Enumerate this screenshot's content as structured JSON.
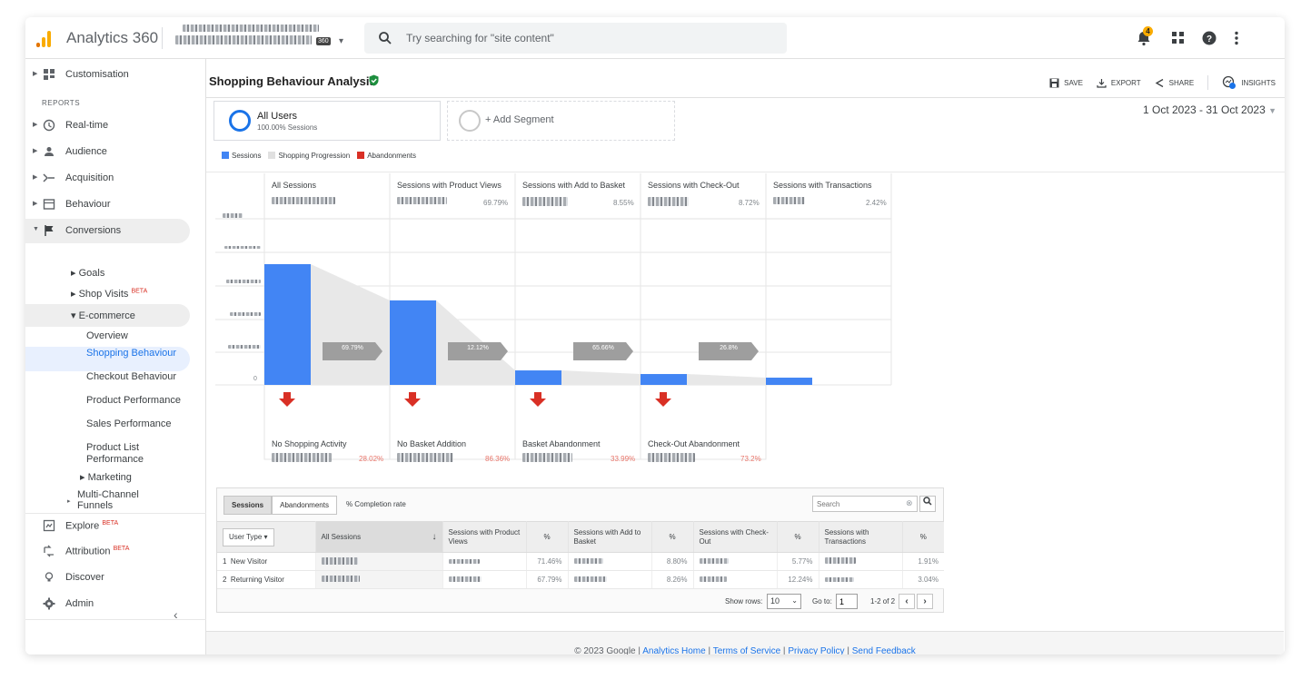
{
  "app": {
    "title": "Analytics 360",
    "search_placeholder": "Try searching for \"site content\"",
    "notification_count": "4",
    "account_badge": "360"
  },
  "sidebar": {
    "customisation": "Customisation",
    "reports_heading": "REPORTS",
    "items": [
      {
        "label": "Real-time"
      },
      {
        "label": "Audience"
      },
      {
        "label": "Acquisition"
      },
      {
        "label": "Behaviour"
      },
      {
        "label": "Conversions"
      }
    ],
    "conversions": {
      "goals": "Goals",
      "shop_visits": "Shop Visits",
      "beta": "BETA",
      "ecommerce": "E-commerce",
      "sub": [
        "Overview",
        "Shopping Behaviour",
        "Checkout Behaviour",
        "Product Performance",
        "Sales Performance",
        "Product List Performance"
      ],
      "marketing": "Marketing",
      "multichannel": "Multi-Channel Funnels"
    },
    "explore": "Explore",
    "attribution": "Attribution",
    "discover": "Discover",
    "admin": "Admin"
  },
  "page": {
    "title": "Shopping Behaviour Analysis",
    "toolbar": {
      "save": "SAVE",
      "export": "EXPORT",
      "share": "SHARE",
      "insights": "INSIGHTS"
    },
    "date_range": "1 Oct 2023 - 31 Oct 2023",
    "segments": [
      {
        "name": "All Users",
        "sub": "100.00% Sessions"
      },
      {
        "name": "+ Add Segment"
      }
    ],
    "legend": [
      "Sessions",
      "Shopping Progression",
      "Abandonments"
    ],
    "colors": {
      "sessions": "#4285f4",
      "progression": "#e8e8e8",
      "abandonment": "#d93025",
      "arrow": "#9e9e9e"
    }
  },
  "funnel": {
    "stages": [
      {
        "label": "All Sessions",
        "pct": ""
      },
      {
        "label": "Sessions with Product Views",
        "pct": "69.79%"
      },
      {
        "label": "Sessions with Add to Basket",
        "pct": "8.55%"
      },
      {
        "label": "Sessions with Check-Out",
        "pct": "8.72%"
      },
      {
        "label": "Sessions with Transactions",
        "pct": "2.42%"
      }
    ],
    "bar_levels": [
      1.0,
      0.7,
      0.12,
      0.09,
      0.06
    ],
    "progression": [
      "69.79%",
      "12.12%",
      "65.66%",
      "26.8%"
    ],
    "abandonments": [
      {
        "label": "No Shopping Activity",
        "pct": "28.02%"
      },
      {
        "label": "No Basket Addition",
        "pct": "86.36%"
      },
      {
        "label": "Basket Abandonment",
        "pct": "33.99%"
      },
      {
        "label": "Check-Out Abandonment",
        "pct": "73.2%"
      }
    ],
    "y_zero": "0"
  },
  "table": {
    "tabs": [
      "Sessions",
      "Abandonments"
    ],
    "completion_tab": "% Completion rate",
    "search_placeholder": "Search",
    "headers": [
      "User Type",
      "All Sessions",
      "Sessions with Product Views",
      "%",
      "Sessions with Add to Basket",
      "%",
      "Sessions with Check-Out",
      "%",
      "Sessions with Transactions",
      "%"
    ],
    "rows": [
      {
        "idx": "1",
        "type": "New Visitor",
        "p1": "71.46%",
        "p2": "8.80%",
        "p3": "5.77%",
        "p4": "1.91%"
      },
      {
        "idx": "2",
        "type": "Returning Visitor",
        "p1": "67.79%",
        "p2": "8.26%",
        "p3": "12.24%",
        "p4": "3.04%"
      }
    ],
    "show_rows_label": "Show rows:",
    "show_rows_value": "10",
    "goto_label": "Go to:",
    "goto_value": "1",
    "range": "1-2 of 2"
  },
  "footer": {
    "copyright": "© 2023 Google |",
    "links": [
      "Analytics Home",
      "Terms of Service",
      "Privacy Policy",
      "Send Feedback"
    ]
  }
}
